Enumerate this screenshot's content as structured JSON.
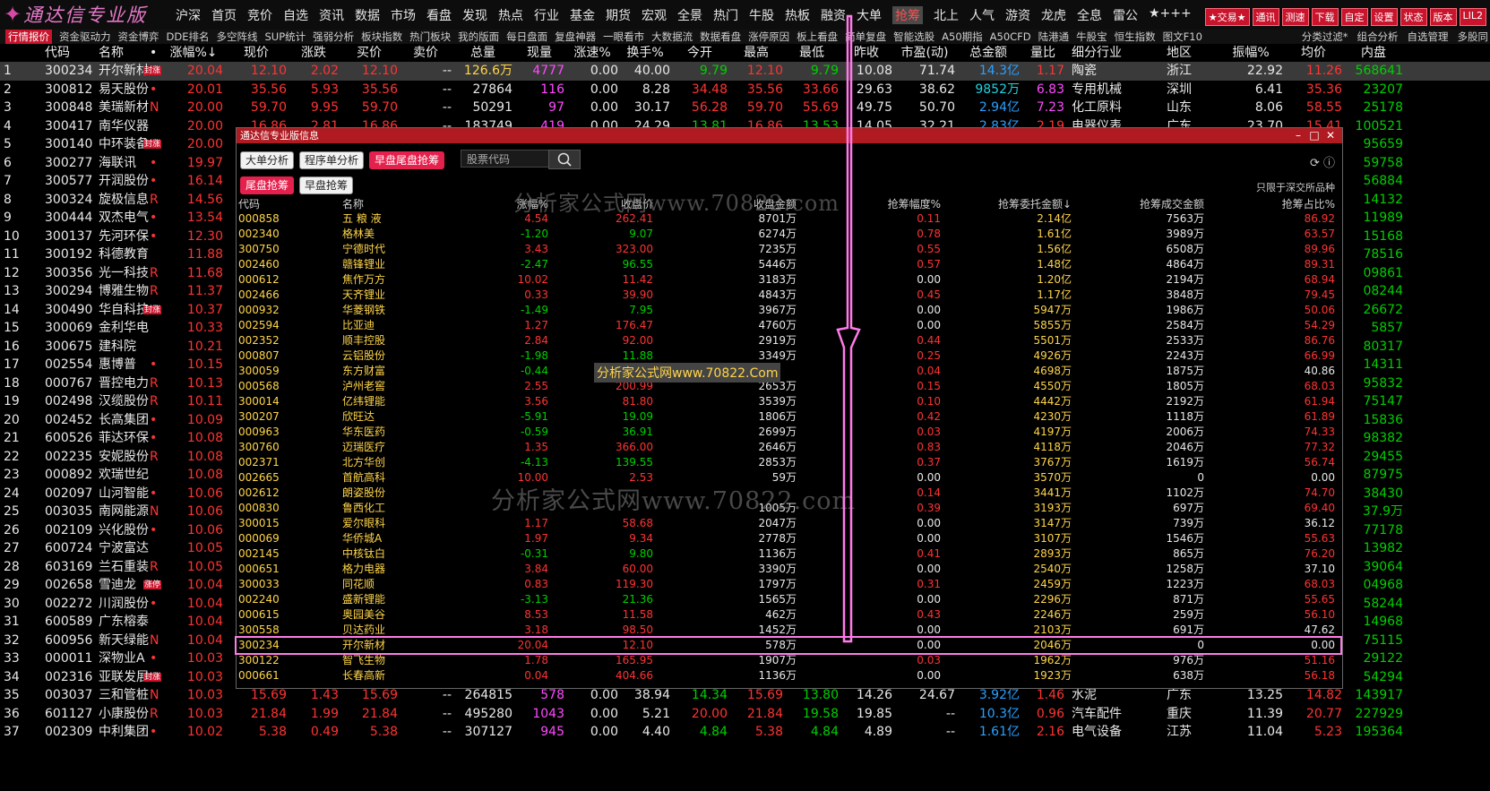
{
  "app": {
    "logo_text": "通达信专业版"
  },
  "menu": [
    "沪深",
    "首页",
    "竞价",
    "自选",
    "资讯",
    "数据",
    "市场",
    "看盘",
    "发现",
    "热点",
    "行业",
    "基金",
    "期货",
    "宏观",
    "全景",
    "热门",
    "牛股",
    "热板",
    "融资",
    "大单",
    "抢筹",
    "北上",
    "人气",
    "游资",
    "龙虎",
    "全息",
    "雷公",
    "★+++"
  ],
  "menu_active": "抢筹",
  "right_buttons": [
    "★交易★",
    "通讯",
    "测速",
    "下载",
    "自定",
    "设置",
    "状态",
    "版本",
    "LIL2"
  ],
  "tabs": [
    "行情报价",
    "资金驱动力",
    "资金博弈",
    "DDE排名",
    "多空阵线",
    "SUP统计",
    "强弱分析",
    "板块指数",
    "热门板块",
    "我的版面",
    "每日盘面",
    "复盘神器",
    "一眼看市",
    "大数据流",
    "数据看盘",
    "涨停原因",
    "板上看盘",
    "简单复盘",
    "智能选股",
    "A50期指",
    "A50CFD",
    "陆港通",
    "牛股宝",
    "恒生指数",
    "图文F10"
  ],
  "tabs_active": "行情报价",
  "right_tabs": [
    "分类过滤*",
    "组合分析",
    "自选管理",
    "多股同"
  ],
  "main_header": [
    "",
    "代码",
    "名称",
    "•",
    "涨幅%↓",
    "现价",
    "涨跌",
    "买价",
    "卖价",
    "总量",
    "现量",
    "涨速%",
    "换手%",
    "今开",
    "最高",
    "最低",
    "昨收",
    "市盈(动)",
    "总金额",
    "量比",
    "细分行业",
    "地区",
    "振幅%",
    "均价",
    "内盘"
  ],
  "main_rows": [
    {
      "i": "1",
      "code": "300234",
      "name": "开尔新材",
      "tag": "封涨",
      "flag": "",
      "pct": "20.04",
      "price": "12.10",
      "chg": "2.02",
      "bid": "12.10",
      "ask": "--",
      "vol": "126.6万",
      "cur": "4777",
      "spd": "0.00",
      "turn": "40.00",
      "open": "9.79",
      "high": "12.10",
      "low": "9.79",
      "prev": "10.08",
      "pe": "71.74",
      "amt": "14.3亿",
      "vr": "1.17",
      "ind": "陶瓷",
      "area": "浙江",
      "amp": "22.92",
      "avg": "11.26",
      "inner": "568641"
    },
    {
      "i": "2",
      "code": "300812",
      "name": "易天股份",
      "tag": "",
      "flag": "•",
      "pct": "20.01",
      "price": "35.56",
      "chg": "5.93",
      "bid": "35.56",
      "ask": "--",
      "vol": "27864",
      "cur": "116",
      "spd": "0.00",
      "turn": "8.28",
      "open": "34.48",
      "high": "35.56",
      "low": "33.66",
      "prev": "29.63",
      "pe": "38.62",
      "amt": "9852万",
      "vr": "6.83",
      "ind": "专用机械",
      "area": "深圳",
      "amp": "6.41",
      "avg": "35.36",
      "inner": "23207"
    },
    {
      "i": "3",
      "code": "300848",
      "name": "美瑞新材",
      "tag": "",
      "flag": "N",
      "pct": "20.00",
      "price": "59.70",
      "chg": "9.95",
      "bid": "59.70",
      "ask": "--",
      "vol": "50291",
      "cur": "97",
      "spd": "0.00",
      "turn": "30.17",
      "open": "56.28",
      "high": "59.70",
      "low": "55.69",
      "prev": "49.75",
      "pe": "50.70",
      "amt": "2.94亿",
      "vr": "7.23",
      "ind": "化工原料",
      "area": "山东",
      "amp": "8.06",
      "avg": "58.55",
      "inner": "25178"
    },
    {
      "i": "4",
      "code": "300417",
      "name": "南华仪器",
      "tag": "",
      "flag": "",
      "pct": "20.00",
      "price": "16.86",
      "chg": "2.81",
      "bid": "16.86",
      "ask": "--",
      "vol": "183749",
      "cur": "419",
      "spd": "0.00",
      "turn": "24.29",
      "open": "13.81",
      "high": "16.86",
      "low": "13.53",
      "prev": "14.05",
      "pe": "32.21",
      "amt": "2.83亿",
      "vr": "2.19",
      "ind": "电器仪表",
      "area": "广东",
      "amp": "23.70",
      "avg": "15.41",
      "inner": "100521"
    },
    {
      "i": "5",
      "code": "300140",
      "name": "中环装备",
      "tag": "封涨",
      "flag": "",
      "pct": "20.00",
      "inner": "95659"
    },
    {
      "i": "6",
      "code": "300277",
      "name": "海联讯",
      "tag": "",
      "flag": "•",
      "pct": "19.97",
      "inner": "59758"
    },
    {
      "i": "7",
      "code": "300577",
      "name": "开润股份",
      "tag": "",
      "flag": "•",
      "pct": "16.14",
      "inner": "56884"
    },
    {
      "i": "8",
      "code": "300324",
      "name": "旋极信息",
      "tag": "",
      "flag": "R",
      "pct": "14.56",
      "inner": "14132"
    },
    {
      "i": "9",
      "code": "300444",
      "name": "双杰电气",
      "tag": "",
      "flag": "•",
      "pct": "13.54",
      "inner": "11989"
    },
    {
      "i": "10",
      "code": "300137",
      "name": "先河环保",
      "tag": "",
      "flag": "•",
      "pct": "12.30",
      "inner": "15168"
    },
    {
      "i": "11",
      "code": "300192",
      "name": "科德教育",
      "tag": "",
      "flag": "",
      "pct": "11.88",
      "inner": "78516"
    },
    {
      "i": "12",
      "code": "300356",
      "name": "光一科技",
      "tag": "",
      "flag": "R",
      "pct": "11.68",
      "inner": "09861"
    },
    {
      "i": "13",
      "code": "300294",
      "name": "博雅生物",
      "tag": "",
      "flag": "R",
      "pct": "11.37",
      "inner": "08244"
    },
    {
      "i": "14",
      "code": "300490",
      "name": "华自科技",
      "tag": "封涨",
      "flag": "",
      "pct": "10.37",
      "inner": "26672"
    },
    {
      "i": "15",
      "code": "300069",
      "name": "金利华电",
      "tag": "",
      "flag": "",
      "pct": "10.33",
      "inner": "5857"
    },
    {
      "i": "16",
      "code": "300675",
      "name": "建科院",
      "tag": "",
      "flag": "",
      "pct": "10.21",
      "inner": "80317"
    },
    {
      "i": "17",
      "code": "002554",
      "name": "惠博普",
      "tag": "",
      "flag": "•",
      "pct": "10.15",
      "inner": "14311"
    },
    {
      "i": "18",
      "code": "000767",
      "name": "晋控电力",
      "tag": "",
      "flag": "R",
      "pct": "10.13",
      "inner": "95832"
    },
    {
      "i": "19",
      "code": "002498",
      "name": "汉缆股份",
      "tag": "",
      "flag": "R",
      "pct": "10.11",
      "inner": "75147"
    },
    {
      "i": "20",
      "code": "002452",
      "name": "长高集团",
      "tag": "",
      "flag": "•",
      "pct": "10.09",
      "inner": "15836"
    },
    {
      "i": "21",
      "code": "600526",
      "name": "菲达环保",
      "tag": "",
      "flag": "•",
      "pct": "10.08",
      "inner": "98382"
    },
    {
      "i": "22",
      "code": "002235",
      "name": "安妮股份",
      "tag": "",
      "flag": "R",
      "pct": "10.08",
      "inner": "29455"
    },
    {
      "i": "23",
      "code": "000892",
      "name": "欢瑞世纪",
      "tag": "",
      "flag": "",
      "pct": "10.08",
      "inner": "87975"
    },
    {
      "i": "24",
      "code": "002097",
      "name": "山河智能",
      "tag": "",
      "flag": "•",
      "pct": "10.06",
      "inner": "38430"
    },
    {
      "i": "25",
      "code": "003035",
      "name": "南网能源",
      "tag": "",
      "flag": "N",
      "pct": "10.06",
      "inner": "37.9万"
    },
    {
      "i": "26",
      "code": "002109",
      "name": "兴化股份",
      "tag": "",
      "flag": "•",
      "pct": "10.06",
      "inner": "77178"
    },
    {
      "i": "27",
      "code": "600724",
      "name": "宁波富达",
      "tag": "",
      "flag": "",
      "pct": "10.05",
      "inner": "13982"
    },
    {
      "i": "28",
      "code": "603169",
      "name": "兰石重装",
      "tag": "",
      "flag": "R",
      "pct": "10.05",
      "inner": "39064"
    },
    {
      "i": "29",
      "code": "002658",
      "name": "雪迪龙",
      "tag": "涨停",
      "flag": "",
      "pct": "10.04",
      "inner": "04968"
    },
    {
      "i": "30",
      "code": "002272",
      "name": "川润股份",
      "tag": "",
      "flag": "•",
      "pct": "10.04",
      "inner": "58244"
    },
    {
      "i": "31",
      "code": "600589",
      "name": "广东榕泰",
      "tag": "",
      "flag": "",
      "pct": "10.04",
      "inner": "14968"
    },
    {
      "i": "32",
      "code": "600956",
      "name": "新天绿能",
      "tag": "",
      "flag": "N",
      "pct": "10.04",
      "inner": "75115"
    },
    {
      "i": "33",
      "code": "000011",
      "name": "深物业A",
      "tag": "",
      "flag": "•",
      "pct": "10.03",
      "inner": "29122"
    },
    {
      "i": "34",
      "code": "002316",
      "name": "亚联发展",
      "tag": "封涨",
      "flag": "",
      "pct": "10.03",
      "inner": "54294"
    },
    {
      "i": "35",
      "code": "003037",
      "name": "三和管桩",
      "tag": "",
      "flag": "N",
      "pct": "10.03",
      "price": "15.69",
      "chg": "1.43",
      "bid": "15.69",
      "ask": "--",
      "vol": "264815",
      "cur": "578",
      "spd": "0.00",
      "turn": "38.94",
      "open": "14.34",
      "high": "15.69",
      "low": "13.80",
      "prev": "14.26",
      "pe": "24.67",
      "amt": "3.92亿",
      "vr": "1.46",
      "ind": "水泥",
      "area": "广东",
      "amp": "13.25",
      "avg": "14.82",
      "inner": "143917"
    },
    {
      "i": "36",
      "code": "601127",
      "name": "小康股份",
      "tag": "",
      "flag": "R",
      "pct": "10.03",
      "price": "21.84",
      "chg": "1.99",
      "bid": "21.84",
      "ask": "--",
      "vol": "495280",
      "cur": "1043",
      "spd": "0.00",
      "turn": "5.21",
      "open": "20.00",
      "high": "21.84",
      "low": "19.58",
      "prev": "19.85",
      "pe": "--",
      "amt": "10.3亿",
      "vr": "0.96",
      "ind": "汽车配件",
      "area": "重庆",
      "amp": "11.39",
      "avg": "20.77",
      "inner": "227929"
    },
    {
      "i": "37",
      "code": "002309",
      "name": "中利集团",
      "tag": "",
      "flag": "•",
      "pct": "10.02",
      "price": "5.38",
      "chg": "0.49",
      "bid": "5.38",
      "ask": "--",
      "vol": "307127",
      "cur": "945",
      "spd": "0.00",
      "turn": "4.40",
      "open": "4.84",
      "high": "5.38",
      "low": "4.84",
      "prev": "4.89",
      "pe": "--",
      "amt": "1.61亿",
      "vr": "2.16",
      "ind": "电气设备",
      "area": "江苏",
      "amp": "11.04",
      "avg": "5.23",
      "inner": "195364"
    }
  ],
  "dialog": {
    "title": "通达信专业版信息",
    "tabs": [
      "大单分析",
      "程序单分析",
      "早盘尾盘抢筹"
    ],
    "tabs_active": "早盘尾盘抢筹",
    "search_placeholder": "股票代码",
    "sub_tabs": [
      "尾盘抢筹",
      "早盘抢筹"
    ],
    "sub_active": "尾盘抢筹",
    "note": "只限于深交所品种",
    "headers": [
      "代码",
      "名称",
      "涨幅%",
      "收盘价",
      "收盘金额",
      "抢筹幅度%",
      "抢筹委托金额↓",
      "抢筹成交金额",
      "抢筹占比%"
    ],
    "rows": [
      [
        "000858",
        "五 粮 液",
        "4.54",
        "262.41",
        "8701万",
        "0.11",
        "2.14亿",
        "7563万",
        "86.92"
      ],
      [
        "002340",
        "格林美",
        "-1.20",
        "9.07",
        "6274万",
        "0.78",
        "1.61亿",
        "3989万",
        "63.57"
      ],
      [
        "300750",
        "宁德时代",
        "3.43",
        "323.00",
        "7235万",
        "0.55",
        "1.56亿",
        "6508万",
        "89.96"
      ],
      [
        "002460",
        "赣锋锂业",
        "-2.47",
        "96.55",
        "5446万",
        "0.57",
        "1.48亿",
        "4864万",
        "89.31"
      ],
      [
        "000612",
        "焦作万方",
        "10.02",
        "11.42",
        "3183万",
        "0.00",
        "1.20亿",
        "2194万",
        "68.94"
      ],
      [
        "002466",
        "天齐锂业",
        "0.33",
        "39.90",
        "4843万",
        "0.45",
        "1.17亿",
        "3848万",
        "79.45"
      ],
      [
        "000932",
        "华菱钢铁",
        "-1.49",
        "7.95",
        "3967万",
        "0.00",
        "5947万",
        "1986万",
        "50.06"
      ],
      [
        "002594",
        "比亚迪",
        "1.27",
        "176.47",
        "4760万",
        "0.00",
        "5855万",
        "2584万",
        "54.29"
      ],
      [
        "002352",
        "顺丰控股",
        "2.84",
        "92.00",
        "2919万",
        "0.44",
        "5501万",
        "2533万",
        "86.76"
      ],
      [
        "000807",
        "云铝股份",
        "-1.98",
        "11.88",
        "3349万",
        "0.25",
        "4926万",
        "2243万",
        "66.99"
      ],
      [
        "300059",
        "东方财富",
        "-0.44",
        "",
        "",
        "0.04",
        "4698万",
        "1875万",
        "40.86"
      ],
      [
        "000568",
        "泸州老窖",
        "2.55",
        "200.99",
        "2653万",
        "0.15",
        "4550万",
        "1805万",
        "68.03"
      ],
      [
        "300014",
        "亿纬锂能",
        "3.56",
        "81.80",
        "3539万",
        "0.10",
        "4442万",
        "2192万",
        "61.94"
      ],
      [
        "300207",
        "欣旺达",
        "-5.91",
        "19.09",
        "1806万",
        "0.42",
        "4230万",
        "1118万",
        "61.89"
      ],
      [
        "000963",
        "华东医药",
        "-0.59",
        "36.91",
        "2699万",
        "0.03",
        "4197万",
        "2006万",
        "74.33"
      ],
      [
        "300760",
        "迈瑞医疗",
        "1.35",
        "366.00",
        "2646万",
        "0.83",
        "4118万",
        "2046万",
        "77.32"
      ],
      [
        "002371",
        "北方华创",
        "-4.13",
        "139.55",
        "2853万",
        "0.37",
        "3767万",
        "1619万",
        "56.74"
      ],
      [
        "002665",
        "首航高科",
        "10.00",
        "2.53",
        "59万",
        "0.00",
        "3570万",
        "0",
        "0.00"
      ],
      [
        "002612",
        "朗姿股份",
        "",
        "",
        "",
        "0.14",
        "3441万",
        "1102万",
        "74.70"
      ],
      [
        "000830",
        "鲁西化工",
        "",
        "",
        "1005万",
        "0.39",
        "3193万",
        "697万",
        "69.40"
      ],
      [
        "300015",
        "爱尔眼科",
        "1.17",
        "58.68",
        "2047万",
        "0.00",
        "3147万",
        "739万",
        "36.12"
      ],
      [
        "000069",
        "华侨城A",
        "1.97",
        "9.34",
        "2778万",
        "0.00",
        "3107万",
        "1546万",
        "55.63"
      ],
      [
        "002145",
        "中核钛白",
        "-0.31",
        "9.80",
        "1136万",
        "0.41",
        "2893万",
        "865万",
        "76.20"
      ],
      [
        "000651",
        "格力电器",
        "3.84",
        "60.00",
        "3390万",
        "0.00",
        "2540万",
        "1258万",
        "37.10"
      ],
      [
        "300033",
        "同花顺",
        "0.83",
        "119.30",
        "1797万",
        "0.31",
        "2459万",
        "1223万",
        "68.03"
      ],
      [
        "002240",
        "盛新锂能",
        "-3.13",
        "21.36",
        "1565万",
        "0.00",
        "2296万",
        "871万",
        "55.65"
      ],
      [
        "000615",
        "奥园美谷",
        "8.53",
        "11.58",
        "462万",
        "0.43",
        "2246万",
        "259万",
        "56.10"
      ],
      [
        "300558",
        "贝达药业",
        "3.18",
        "98.50",
        "1452万",
        "0.00",
        "2103万",
        "691万",
        "47.62"
      ],
      [
        "300234",
        "开尔新材",
        "20.04",
        "12.10",
        "578万",
        "0.00",
        "2046万",
        "0",
        "0.00"
      ],
      [
        "300122",
        "智飞生物",
        "1.78",
        "165.95",
        "1907万",
        "0.03",
        "1962万",
        "976万",
        "51.16"
      ],
      [
        "000661",
        "长春高新",
        "0.04",
        "404.66",
        "1136万",
        "0.00",
        "1923万",
        "638万",
        "56.18"
      ]
    ],
    "highlight_row": 28
  },
  "watermarks": [
    "分析家公式网www.70822.com",
    "分析家公式网www.70822.Com",
    "分析家公式网www.70822.com"
  ],
  "colors": {
    "up": "#ff3333",
    "down": "#00d000",
    "accent": "#c8142c",
    "code": "#ffd54a",
    "highlight": "#ff7be8"
  }
}
